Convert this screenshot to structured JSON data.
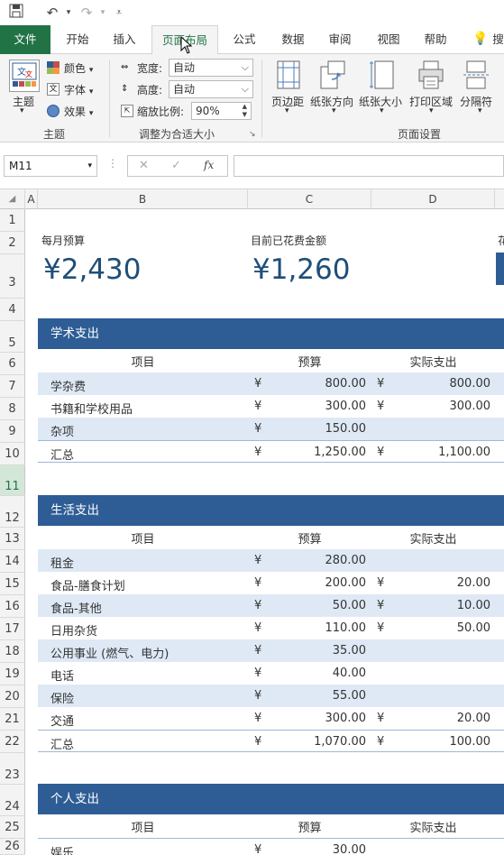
{
  "qat": {
    "save_icon": "save-icon",
    "undo_icon": "undo-icon",
    "redo_icon": "redo-icon",
    "customize_icon": "customize-icon"
  },
  "tabs": [
    {
      "label": "文件"
    },
    {
      "label": "开始"
    },
    {
      "label": "插入"
    },
    {
      "label": "页面布局"
    },
    {
      "label": "公式"
    },
    {
      "label": "数据"
    },
    {
      "label": "审阅"
    },
    {
      "label": "视图"
    },
    {
      "label": "帮助"
    }
  ],
  "ribbon": {
    "theme_group": {
      "themes_label": "主题",
      "colors_label": "颜色",
      "fonts_label": "字体",
      "effects_label": "效果",
      "group_label": "主题"
    },
    "scale_group": {
      "width_label": "宽度:",
      "width_value": "自动",
      "height_label": "高度:",
      "height_value": "自动",
      "scale_label": "缩放比例:",
      "scale_value": "90%",
      "group_label": "调整为合适大小"
    },
    "page_setup_group": {
      "margins_label": "页边距",
      "orientation_label": "纸张方向",
      "size_label": "纸张大小",
      "print_area_label": "打印区域",
      "breaks_label": "分隔符",
      "group_label": "页面设置"
    }
  },
  "formula_bar": {
    "name_box": "M11",
    "fx": "fx",
    "formula": ""
  },
  "columns": [
    "A",
    "B",
    "C",
    "D"
  ],
  "rows": [
    "1",
    "2",
    "3",
    "4",
    "5",
    "6",
    "7",
    "8",
    "9",
    "10",
    "11",
    "12",
    "13",
    "14",
    "15",
    "16",
    "17",
    "18",
    "19",
    "20",
    "21",
    "22",
    "23",
    "24",
    "25",
    "26"
  ],
  "kpi": {
    "budget_label": "每月预算",
    "budget_value": "¥2,430",
    "spent_label": "目前已花费金额",
    "spent_value": "¥1,260",
    "third_label_partial": "花"
  },
  "sections": {
    "academic": {
      "title": "学术支出",
      "headers": {
        "item": "项目",
        "budget": "预算",
        "actual": "实际支出"
      },
      "rows": [
        {
          "item": "学杂费",
          "cur1": "¥",
          "budget": "800.00",
          "cur2": "¥",
          "actual": "800.00"
        },
        {
          "item": "书籍和学校用品",
          "cur1": "¥",
          "budget": "300.00",
          "cur2": "¥",
          "actual": "300.00"
        },
        {
          "item": "杂项",
          "cur1": "¥",
          "budget": "150.00",
          "cur2": "",
          "actual": ""
        },
        {
          "item": "汇总",
          "cur1": "¥",
          "budget": "1,250.00",
          "cur2": "¥",
          "actual": "1,100.00"
        }
      ]
    },
    "living": {
      "title": "生活支出",
      "headers": {
        "item": "项目",
        "budget": "预算",
        "actual": "实际支出"
      },
      "rows": [
        {
          "item": "租金",
          "cur1": "¥",
          "budget": "280.00",
          "cur2": "",
          "actual": ""
        },
        {
          "item": "食品-膳食计划",
          "cur1": "¥",
          "budget": "200.00",
          "cur2": "¥",
          "actual": "20.00"
        },
        {
          "item": "食品-其他",
          "cur1": "¥",
          "budget": "50.00",
          "cur2": "¥",
          "actual": "10.00"
        },
        {
          "item": "日用杂货",
          "cur1": "¥",
          "budget": "110.00",
          "cur2": "¥",
          "actual": "50.00"
        },
        {
          "item": "公用事业 (燃气、电力)",
          "cur1": "¥",
          "budget": "35.00",
          "cur2": "",
          "actual": ""
        },
        {
          "item": "电话",
          "cur1": "¥",
          "budget": "40.00",
          "cur2": "",
          "actual": ""
        },
        {
          "item": "保险",
          "cur1": "¥",
          "budget": "55.00",
          "cur2": "",
          "actual": ""
        },
        {
          "item": "交通",
          "cur1": "¥",
          "budget": "300.00",
          "cur2": "¥",
          "actual": "20.00"
        },
        {
          "item": "汇总",
          "cur1": "¥",
          "budget": "1,070.00",
          "cur2": "¥",
          "actual": "100.00"
        }
      ]
    },
    "personal": {
      "title": "个人支出",
      "headers": {
        "item": "项目",
        "budget": "预算",
        "actual": "实际支出"
      },
      "rows": [
        {
          "item": "娱乐",
          "cur1": "¥",
          "budget": "30.00",
          "cur2": "",
          "actual": ""
        }
      ]
    }
  },
  "colors": {
    "excel_green": "#217346",
    "section_blue": "#2e5d95",
    "band_blue": "#dfe9f5",
    "kpi_text": "#1f4e79"
  }
}
